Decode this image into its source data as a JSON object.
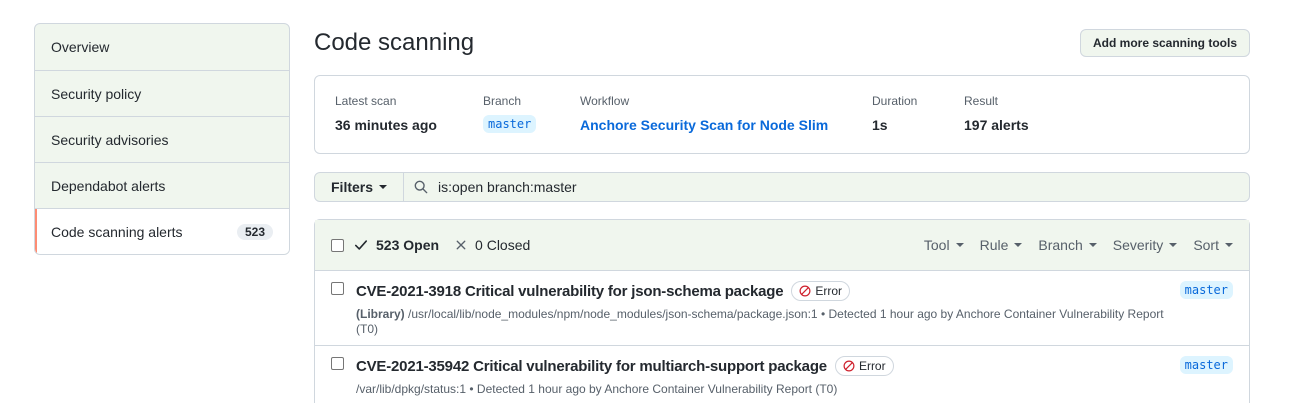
{
  "sidebar": {
    "items": [
      {
        "label": "Overview"
      },
      {
        "label": "Security policy"
      },
      {
        "label": "Security advisories"
      },
      {
        "label": "Dependabot alerts"
      },
      {
        "label": "Code scanning alerts",
        "count": "523"
      }
    ]
  },
  "header": {
    "title": "Code scanning",
    "add_tools_label": "Add more scanning tools"
  },
  "scan": {
    "latest_label": "Latest scan",
    "latest_value": "36 minutes ago",
    "branch_label": "Branch",
    "branch_value": "master",
    "workflow_label": "Workflow",
    "workflow_value": "Anchore Security Scan for Node Slim",
    "duration_label": "Duration",
    "duration_value": "1s",
    "result_label": "Result",
    "result_value": "197 alerts"
  },
  "filters": {
    "label": "Filters",
    "query": "is:open branch:master"
  },
  "results": {
    "open_label": "523 Open",
    "closed_label": "0 Closed",
    "sorters": [
      "Tool",
      "Rule",
      "Branch",
      "Severity",
      "Sort"
    ],
    "rows": [
      {
        "title": "CVE-2021-3918 Critical vulnerability for json-schema package",
        "severity": "Error",
        "meta_prefix": "(Library)",
        "meta": "/usr/local/lib/node_modules/npm/node_modules/json-schema/package.json:1 • Detected 1 hour ago by Anchore Container Vulnerability Report (T0)",
        "branch": "master"
      },
      {
        "title": "CVE-2021-35942 Critical vulnerability for multiarch-support package",
        "severity": "Error",
        "meta_prefix": "",
        "meta": "/var/lib/dpkg/status:1 • Detected 1 hour ago by Anchore Container Vulnerability Report (T0)",
        "branch": "master"
      }
    ]
  },
  "colors": {
    "accent_link": "#0969da",
    "active_indicator": "#fd8c73",
    "error_icon": "#cf222e",
    "panel_bg": "#f0f6ee"
  },
  "icons": [
    "search-icon",
    "check-icon",
    "x-icon",
    "stop-icon",
    "caret-down-icon"
  ]
}
